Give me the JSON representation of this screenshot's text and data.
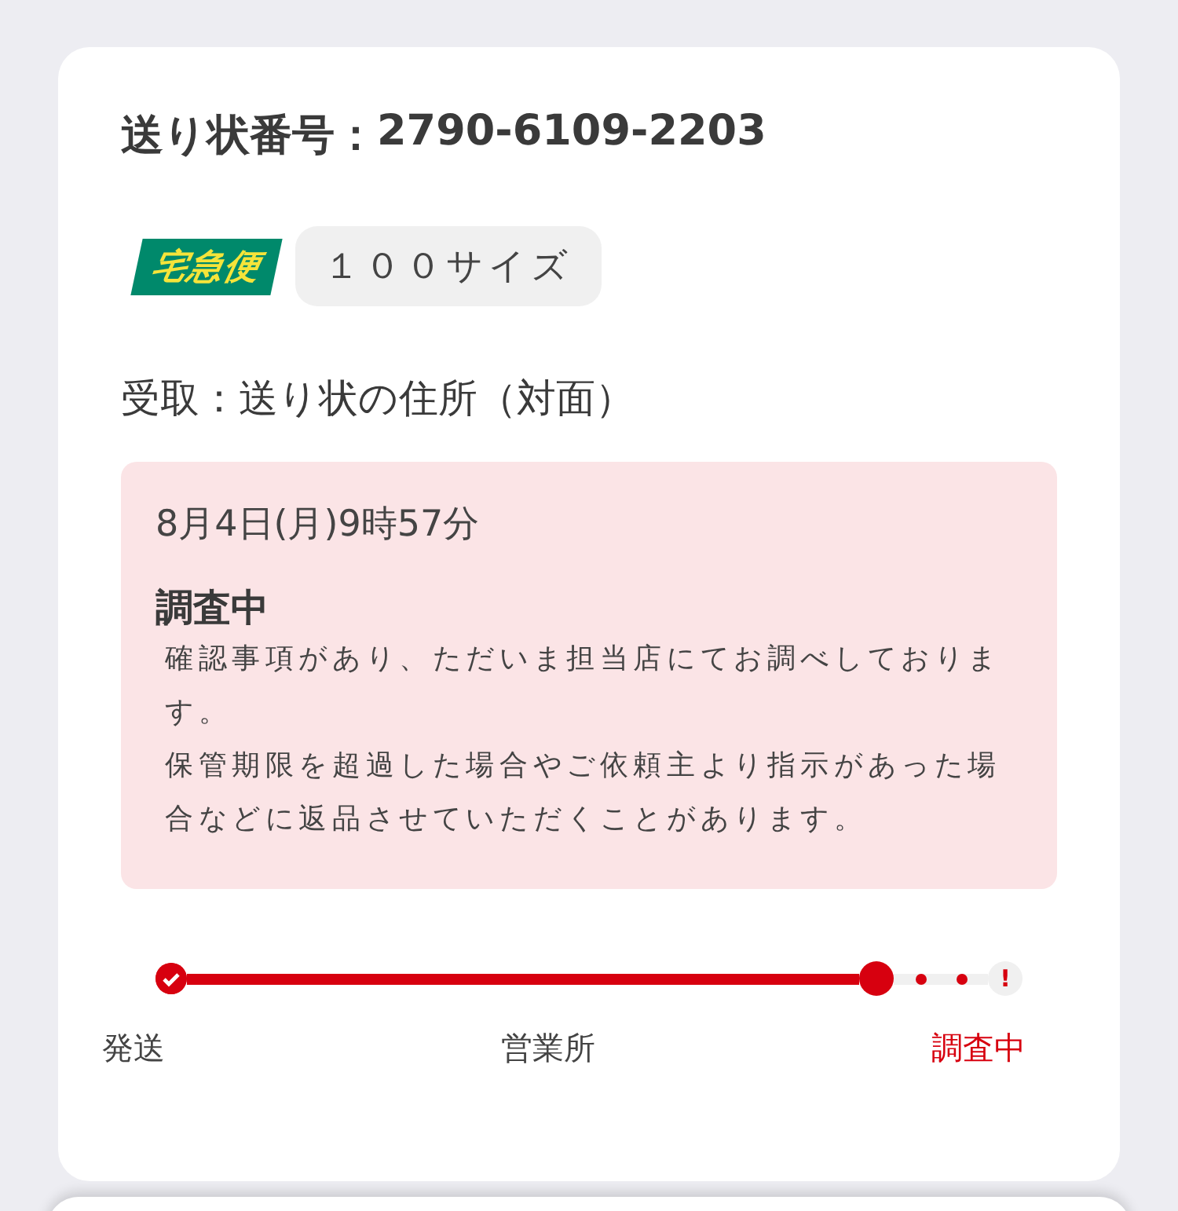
{
  "invoice": {
    "label": "送り状番号：",
    "number": "2790-6109-2203"
  },
  "service_logo": "宅急便",
  "size_badge": "１００サイズ",
  "receipt": "受取：送り状の住所（対面）",
  "status_box": {
    "datetime": "8月4日(月)9時57分",
    "title": "調査中",
    "message": [
      "確認事項があり、ただいま担当店にてお調べしております。",
      "保管期限を超過した場合やご依頼主より指示があった場合などに返品させていただくことがあります。"
    ]
  },
  "timeline": [
    {
      "label": "発送",
      "kind": "done"
    },
    {
      "label": "営業所",
      "kind": "current"
    },
    {
      "label": "調査中",
      "kind": "alert",
      "icon": "!"
    }
  ]
}
